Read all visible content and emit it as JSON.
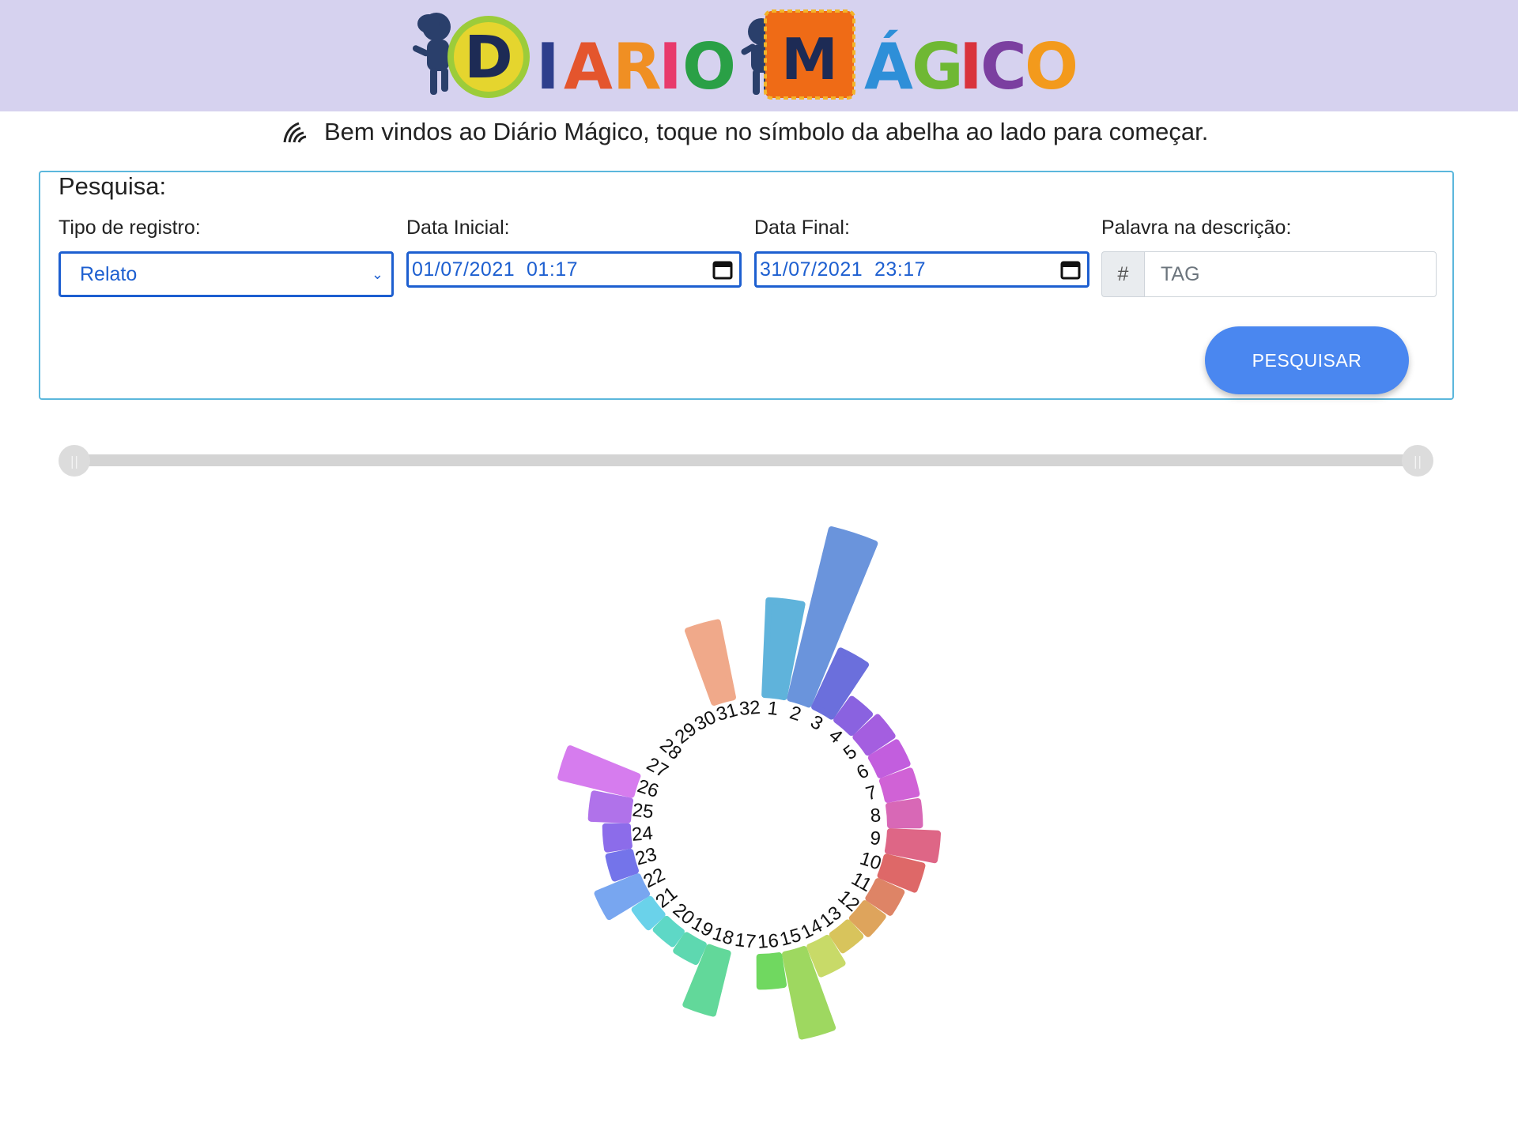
{
  "header": {
    "logo_text": "DIARIO MÁGICO",
    "bg_color": "#d6d2ef"
  },
  "welcome": {
    "icon": "bee-icon",
    "text": "Bem vindos ao Diário Mágico, toque no símbolo da abelha ao lado para começar."
  },
  "search": {
    "title": "Pesquisa:",
    "type_label": "Tipo de registro:",
    "type_value": "Relato",
    "start_label": "Data Inicial:",
    "start_value": "01/07/2021  01:17",
    "end_label": "Data Final:",
    "end_value": "31/07/2021  23:17",
    "word_label": "Palavra na descrição:",
    "word_prefix": "#",
    "word_placeholder": "TAG",
    "button_label": "PESQUISAR",
    "accent_color": "#4a87f0"
  },
  "range_slider": {
    "start": 0,
    "end": 1
  },
  "chart_data": {
    "type": "radial-bar",
    "categories": [
      "1",
      "2",
      "3",
      "4",
      "5",
      "6",
      "7",
      "8",
      "9",
      "10",
      "11",
      "12",
      "13",
      "14",
      "15",
      "16",
      "17",
      "18",
      "19",
      "20",
      "21",
      "22",
      "23",
      "24",
      "25",
      "26",
      "27",
      "28",
      "29",
      "30",
      "31",
      "32"
    ],
    "values": [
      2.4,
      4.6,
      1.5,
      0.5,
      0.6,
      0.6,
      0.6,
      0.6,
      1.1,
      0.8,
      0.5,
      0.4,
      0.3,
      0.6,
      2.1,
      0.6,
      0,
      1.5,
      0.3,
      0.2,
      0.3,
      1.0,
      0.4,
      0.4,
      0.8,
      1.8,
      0,
      0,
      0,
      0,
      1.9,
      0
    ],
    "colors": [
      "#5fb3db",
      "#6a94dc",
      "#6b6fdc",
      "#8a62e0",
      "#a45ee0",
      "#c25ede",
      "#d062d6",
      "#d868b6",
      "#de6686",
      "#de6868",
      "#de8466",
      "#dea45c",
      "#d8c45c",
      "#c8da68",
      "#9ed860",
      "#70d860",
      "#64d880",
      "#62d89a",
      "#5ed8b0",
      "#5ed8c6",
      "#6ad2ea",
      "#78a6f0",
      "#7474ea",
      "#8c6cea",
      "#b072ea",
      "#d67cee",
      "#e078d0",
      "#e278b8",
      "#ea8fa2",
      "#f0a090",
      "#f0a98a",
      "#f4b090"
    ],
    "ylim": [
      0,
      4.6
    ],
    "grid": false
  }
}
